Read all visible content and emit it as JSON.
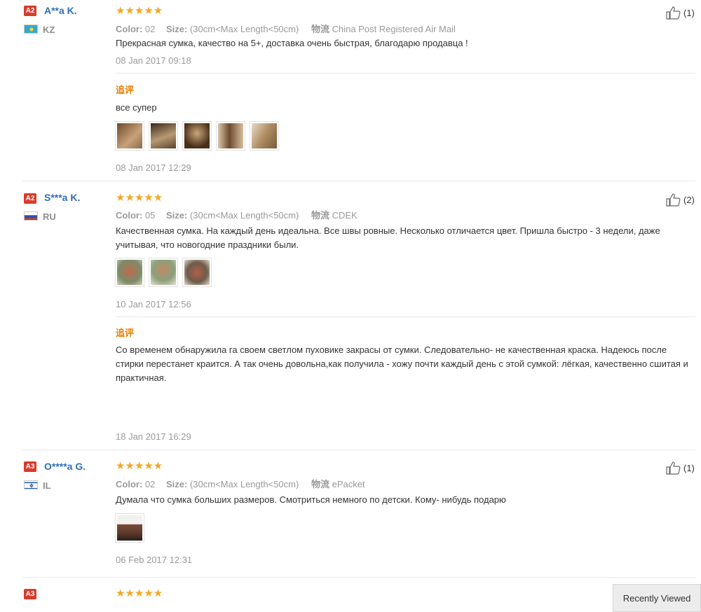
{
  "reviews": [
    {
      "level": "A2",
      "name": "A**a K.",
      "country": "KZ",
      "rating": "★★★★★",
      "color_label": "Color:",
      "color_value": "02",
      "size_label": "Size:",
      "size_value": "(30cm<Max Length<50cm)",
      "shipping_label": "物流",
      "shipping_value": "China Post Registered Air Mail",
      "text": "Прекрасная сумка, качество на 5+, доставка очень быстрая, благодарю продавца !",
      "date": "08 Jan 2017 09:18",
      "likes": "(1)",
      "additional_label": "追评",
      "additional_text": "все супер",
      "additional_date": "08 Jan 2017 12:29"
    },
    {
      "level": "A2",
      "name": "S***a K.",
      "country": "RU",
      "rating": "★★★★★",
      "color_label": "Color:",
      "color_value": "05",
      "size_label": "Size:",
      "size_value": "(30cm<Max Length<50cm)",
      "shipping_label": "物流",
      "shipping_value": "CDEK",
      "text": "Качественная сумка. На каждый день идеальна. Все швы ровные. Несколько отличается цвет. Пришла быстро - 3 недели, даже учитывая, что новогодние праздники были.",
      "date": "10 Jan 2017 12:56",
      "likes": "(2)",
      "additional_label": "追评",
      "additional_text": "Со временем обнаружила га своем светлом пуховике закрасы от сумки. Следовательно- не качественная краска. Надеюсь после стирки перестанет краится. А так очень довольна,как получила - хожу почти каждый день с этой сумкой: лёгкая, качественно сшитая и практичная.",
      "additional_date": "18 Jan 2017 16:29"
    },
    {
      "level": "A3",
      "name": "O****a G.",
      "country": "IL",
      "rating": "★★★★★",
      "color_label": "Color:",
      "color_value": "02",
      "size_label": "Size:",
      "size_value": "(30cm<Max Length<50cm)",
      "shipping_label": "物流",
      "shipping_value": "ePacket",
      "text": "Думала что сумка больших размеров. Смотриться немного по детски. Кому- нибудь подарю",
      "date": "06 Feb 2017 12:31",
      "likes": "(1)"
    },
    {
      "level": "A3",
      "rating": "★★★★★"
    }
  ],
  "recently_viewed": "Recently Viewed",
  "colors": {
    "star": "#f5a623",
    "name_link": "#2d6fb5",
    "badge": "#d93b2b",
    "additional_label": "#e67e00"
  },
  "icons": [
    "thumbs-up-icon",
    "flag-icon",
    "photo-thumbnail"
  ]
}
